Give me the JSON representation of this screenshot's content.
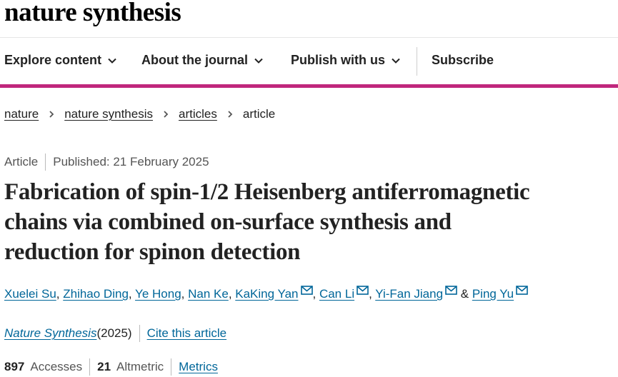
{
  "header": {
    "brand": "nature synthesis"
  },
  "nav": {
    "items": [
      {
        "label": "Explore content",
        "icon": "chevron-down-icon"
      },
      {
        "label": "About the journal",
        "icon": "chevron-down-icon"
      },
      {
        "label": "Publish with us",
        "icon": "chevron-down-icon"
      }
    ],
    "subscribe": "Subscribe",
    "accent_color": "#c0267c"
  },
  "breadcrumb": {
    "items": [
      "nature",
      "nature synthesis",
      "articles"
    ],
    "current": "article",
    "separator_icon": "chevron-right-icon"
  },
  "article": {
    "type": "Article",
    "published": "Published: 21 February 2025",
    "title_lines": [
      "Fabrication of spin-1/2 Heisenberg antiferromagnetic",
      "chains via combined on-surface synthesis and",
      "reduction for spinon detection"
    ],
    "authors": [
      {
        "name": "Xuelei Su",
        "email": false
      },
      {
        "name": "Zhihao Ding",
        "email": false
      },
      {
        "name": "Ye Hong",
        "email": false
      },
      {
        "name": "Nan Ke",
        "email": false
      },
      {
        "name": "KaKing Yan",
        "email": true
      },
      {
        "name": "Can Li",
        "email": true
      },
      {
        "name": "Yi-Fan Jiang",
        "email": true
      },
      {
        "name": "Ping Yu",
        "email": true
      }
    ],
    "author_separator": ", ",
    "author_last_separator": " & ",
    "journal": "Nature Synthesis",
    "year": " (2025)",
    "cite_label": "Cite this article",
    "accesses_count": "897",
    "accesses_label": "Accesses",
    "altmetric_count": "21",
    "altmetric_label": "Altmetric",
    "metrics_label": "Metrics",
    "link_color": "#006699"
  }
}
